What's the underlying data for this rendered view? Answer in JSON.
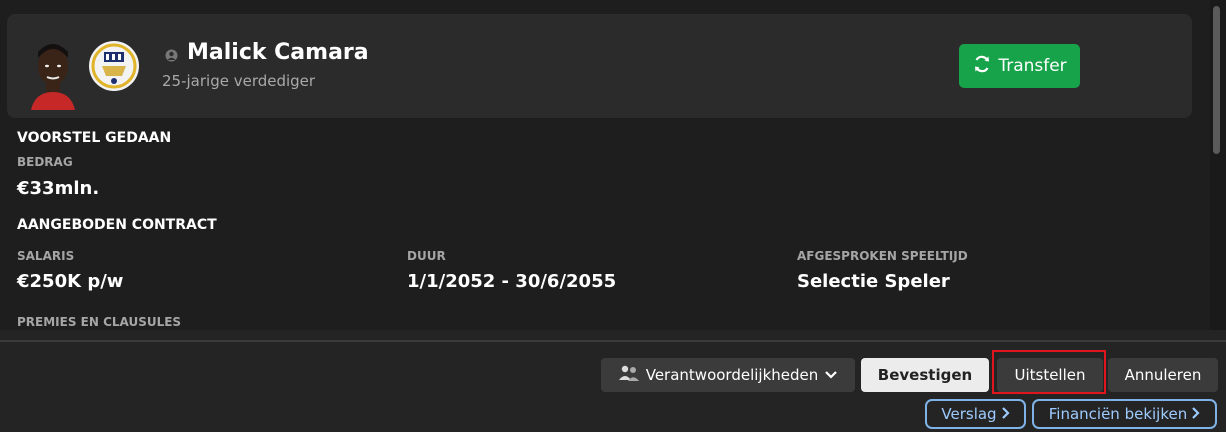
{
  "header": {
    "player_name": "Malick Camara",
    "player_subtitle": "25-jarige verdediger",
    "transfer_label": "Transfer",
    "icons": [
      "player-photo",
      "club-badge-icon",
      "person-icon",
      "refresh-icon"
    ]
  },
  "offer": {
    "title": "VOORSTEL GEDAAN",
    "amount_label": "BEDRAG",
    "amount_value": "€33mln."
  },
  "contract": {
    "title": "AANGEBODEN CONTRACT",
    "salary_label": "SALARIS",
    "salary_value": "€250K p/w",
    "duration_label": "DUUR",
    "duration_value": "1/1/2052 - 30/6/2055",
    "playtime_label": "AFGESPROKEN SPEELTIJD",
    "playtime_value": "Selectie Speler",
    "bonuses_label": "PREMIES EN CLAUSULES"
  },
  "footer": {
    "responsibilities_label": "Verantwoordelijkheden",
    "confirm_label": "Bevestigen",
    "postpone_label": "Uitstellen",
    "cancel_label": "Annuleren",
    "report_label": "Verslag",
    "finances_label": "Financiën bekijken"
  },
  "colors": {
    "transfer_button": "#17a34a",
    "highlight_border": "#e0161f",
    "link_border": "#7fb2e6",
    "background": "#1e1e1e"
  }
}
